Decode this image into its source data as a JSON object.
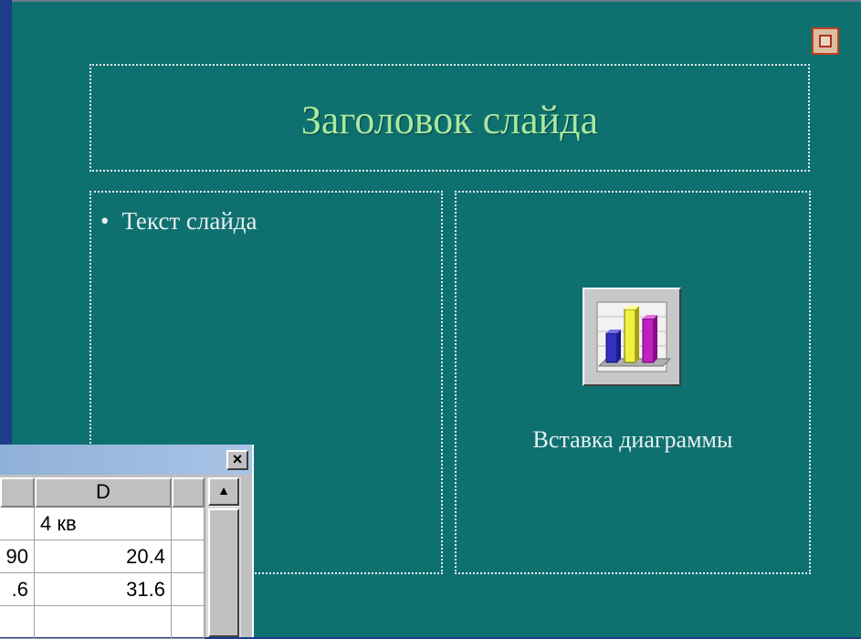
{
  "slide": {
    "title": "Заголовок слайда",
    "body_items": [
      "Текст слайда"
    ],
    "bullet": "•",
    "chart_placeholder_label": "Вставка диаграммы",
    "background_color": "#0f7070",
    "title_color": "#a8e8a0"
  },
  "icons": {
    "chart": "chart-icon",
    "layout": "slide-layout-icon",
    "close": "close-icon",
    "scroll_up": "scroll-up-arrow-icon"
  },
  "datasheet": {
    "close_label": "×",
    "scroll_up_glyph": "▲",
    "columns": [
      "",
      "D"
    ],
    "rows": [
      [
        "",
        "4 кв"
      ],
      [
        "90",
        "20.4"
      ],
      [
        ".6",
        "31.6"
      ]
    ]
  }
}
